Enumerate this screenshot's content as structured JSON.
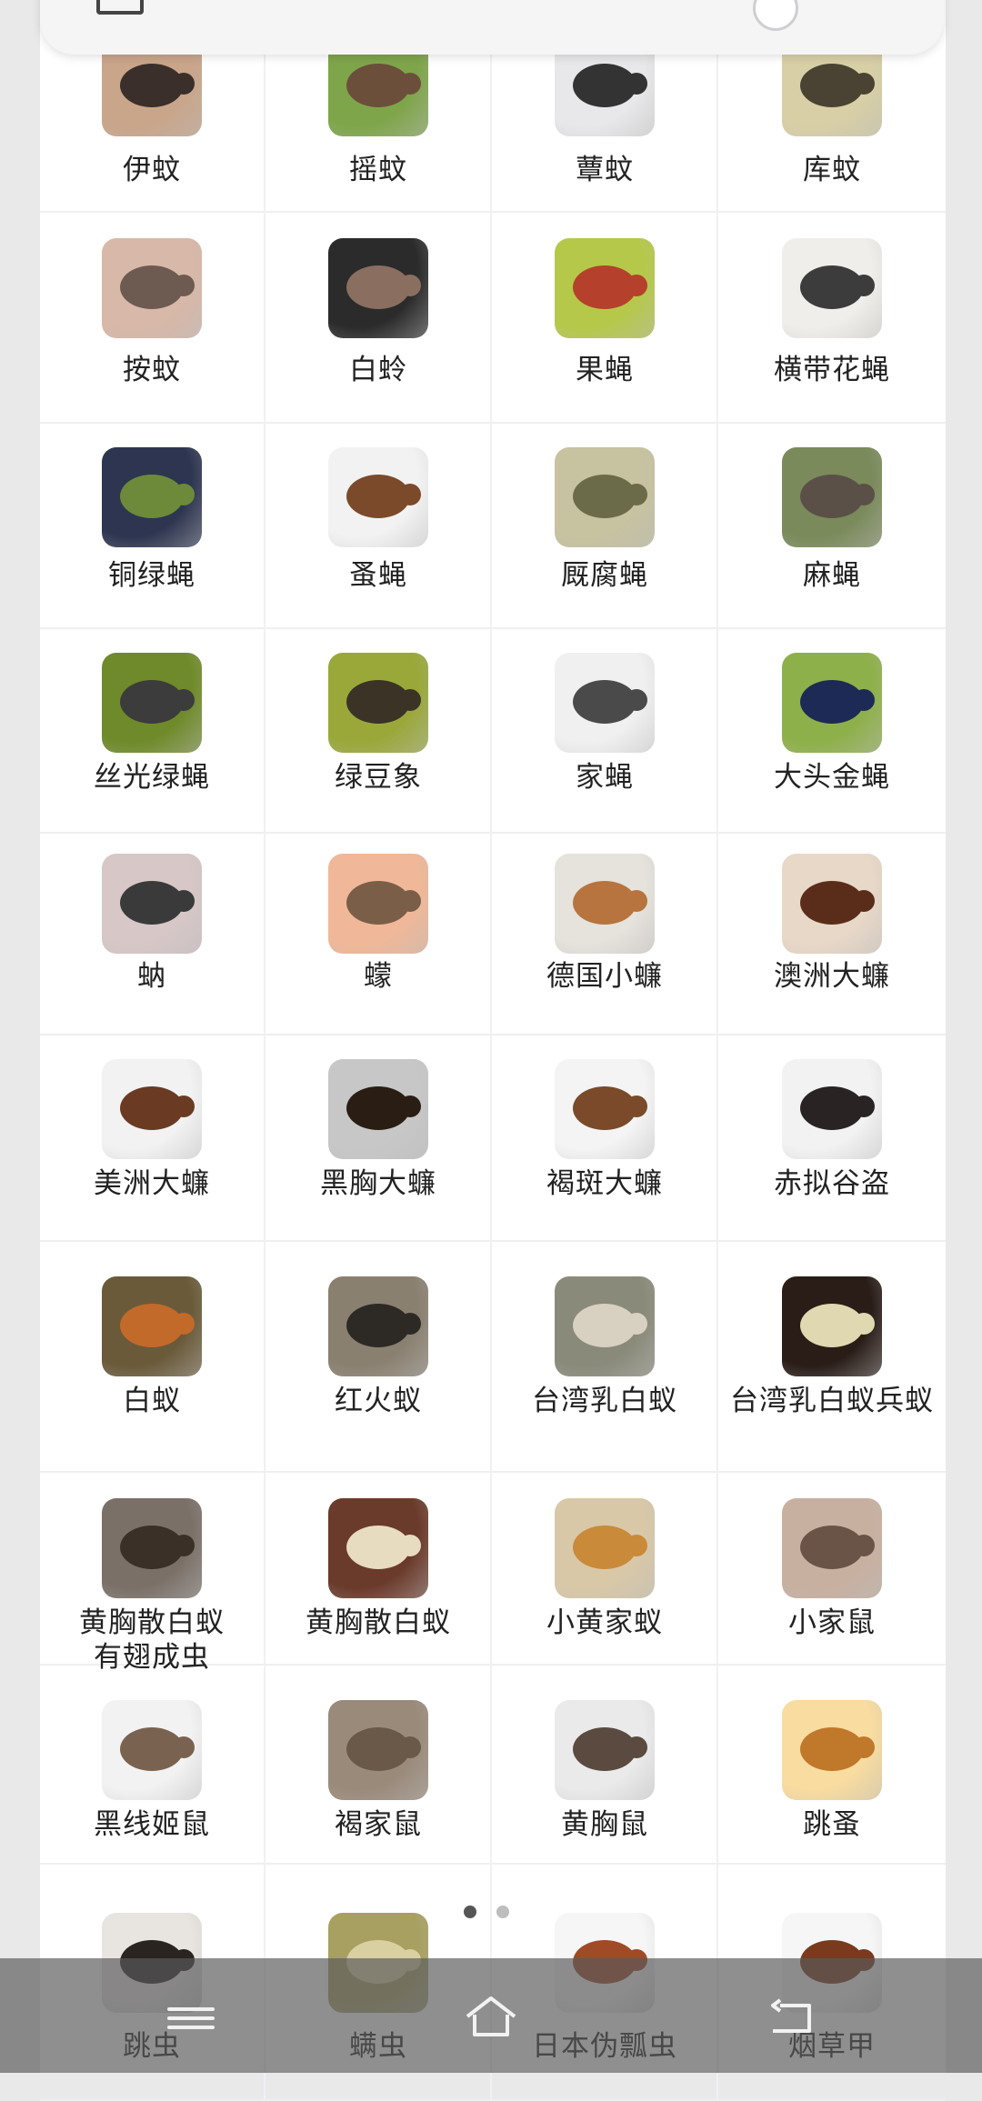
{
  "grid": {
    "rows": [
      [
        "伊蚊",
        "摇蚊",
        "蕈蚊",
        "库蚊"
      ],
      [
        "按蚊",
        "白蛉",
        "果蝇",
        "横带花蝇"
      ],
      [
        "铜绿蝇",
        "蚤蝇",
        "厩腐蝇",
        "麻蝇"
      ],
      [
        "丝光绿蝇",
        "绿豆象",
        "家蝇",
        "大头金蝇"
      ],
      [
        "蚋",
        "蠓",
        "德国小蠊",
        "澳洲大蠊"
      ],
      [
        "美洲大蠊",
        "黑胸大蠊",
        "褐斑大蠊",
        "赤拟谷盗"
      ],
      [
        "白蚁",
        "红火蚁",
        "台湾乳白蚁",
        "台湾乳白蚁兵蚁"
      ],
      [
        "黄胸散白蚁\n有翅成虫",
        "黄胸散白蚁",
        "小黄家蚁",
        "小家鼠"
      ],
      [
        "黑线姬鼠",
        "褐家鼠",
        "黄胸鼠",
        "跳蚤"
      ],
      [
        "跳虫",
        "螨虫",
        "日本伪瓢虫",
        "烟草甲"
      ]
    ]
  },
  "pager": {
    "pages": 2,
    "current": 1
  },
  "navbar": {
    "icons": [
      "menu-icon",
      "home-icon",
      "back-icon"
    ]
  },
  "colors": {
    "label": "#222222",
    "navbar": "#5a5a5c"
  }
}
